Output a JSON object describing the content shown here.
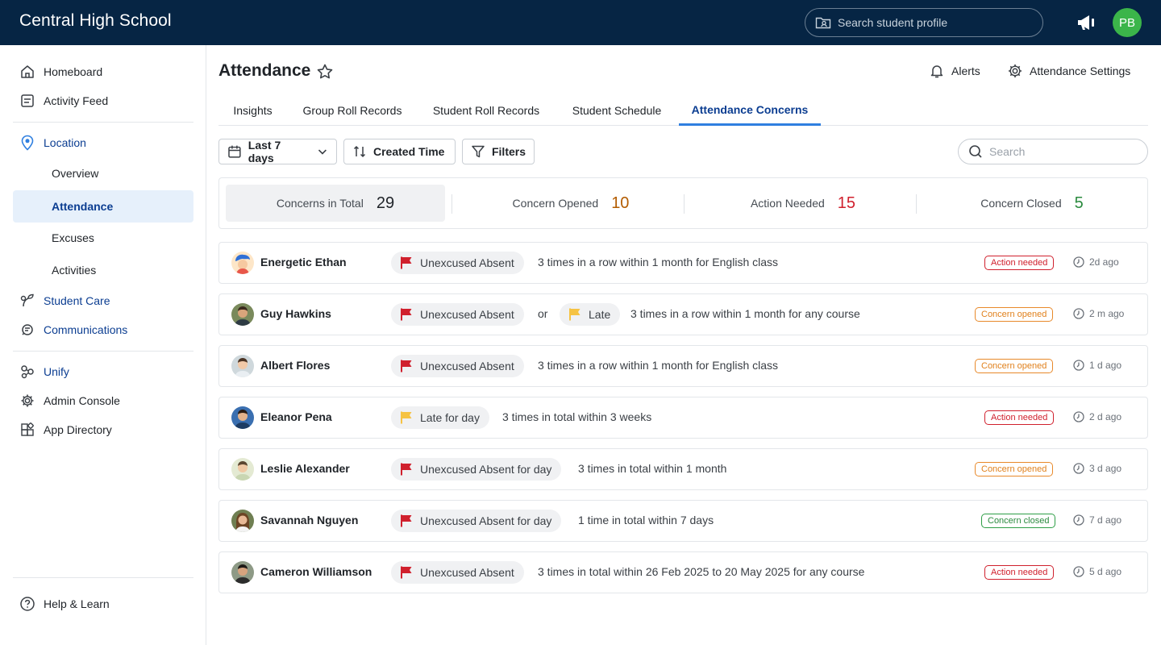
{
  "header": {
    "title": "Central High School",
    "search_placeholder": "Search student profile",
    "megaphone_icon": "megaphone-icon",
    "avatar_initials": "PB",
    "avatar_color": "#3bb54a"
  },
  "sidebar": {
    "items": [
      {
        "label": "Homeboard",
        "icon": "home-icon"
      },
      {
        "label": "Activity Feed",
        "icon": "feed-icon"
      },
      {
        "label": "Location",
        "icon": "location-pin-icon"
      },
      {
        "label": "Student Care",
        "icon": "plant-icon"
      },
      {
        "label": "Communications",
        "icon": "communications-icon"
      },
      {
        "label": "Unify",
        "icon": "unify-icon"
      },
      {
        "label": "Admin Console",
        "icon": "gear-icon"
      },
      {
        "label": "App Directory",
        "icon": "app-grid-icon"
      },
      {
        "label": "Help & Learn",
        "icon": "help-icon"
      }
    ],
    "location_sub": [
      "Overview",
      "Attendance",
      "Excuses",
      "Activities"
    ]
  },
  "page": {
    "title": "Attendance",
    "alerts_label": "Alerts",
    "settings_label": "Attendance Settings"
  },
  "tabs": [
    "Insights",
    "Group Roll Records",
    "Student Roll Records",
    "Student Schedule",
    "Attendance Concerns"
  ],
  "toolbar": {
    "date_range": "Last 7 days",
    "sort": "Created Time",
    "filters": "Filters",
    "search_placeholder": "Search"
  },
  "summary": [
    {
      "label": "Concerns in Total",
      "value": "29",
      "color": "#1f2328"
    },
    {
      "label": "Concern Opened",
      "value": "10",
      "color": "#b35c00"
    },
    {
      "label": "Action Needed",
      "value": "15",
      "color": "#d0202d"
    },
    {
      "label": "Concern Closed",
      "value": "5",
      "color": "#2a8a3e"
    }
  ],
  "concerns": [
    {
      "name": "Energetic Ethan",
      "chips": [
        {
          "label": "Unexcused Absent",
          "flag": "red"
        }
      ],
      "description": "3 times in a row within 1 month for English class",
      "status": "Action needed",
      "status_color": "red",
      "time": "2d ago"
    },
    {
      "name": "Guy Hawkins",
      "chips": [
        {
          "label": "Unexcused Absent",
          "flag": "red"
        },
        {
          "label": "Late",
          "flag": "yellow"
        }
      ],
      "joiner": "or",
      "description": "3 times in a row within 1 month for any course",
      "status": "Concern opened",
      "status_color": "orange",
      "time": "2 m ago"
    },
    {
      "name": "Albert Flores",
      "chips": [
        {
          "label": "Unexcused Absent",
          "flag": "red"
        }
      ],
      "description": "3 times in a row within 1 month for English class",
      "status": "Concern opened",
      "status_color": "orange",
      "time": "1 d ago"
    },
    {
      "name": "Eleanor Pena",
      "chips": [
        {
          "label": "Late for day",
          "flag": "yellow"
        }
      ],
      "description": "3 times in total within 3 weeks",
      "status": "Action needed",
      "status_color": "red",
      "time": "2 d ago"
    },
    {
      "name": "Leslie Alexander",
      "chips": [
        {
          "label": "Unexcused Absent for day",
          "flag": "red"
        }
      ],
      "description": "3 times in total within 1 month",
      "status": "Concern opened",
      "status_color": "orange",
      "time": "3 d ago"
    },
    {
      "name": "Savannah Nguyen",
      "chips": [
        {
          "label": "Unexcused Absent for day",
          "flag": "red"
        }
      ],
      "description": "1 time in total within 7 days",
      "status": "Concern closed",
      "status_color": "green",
      "time": "7 d ago"
    },
    {
      "name": "Cameron Williamson",
      "chips": [
        {
          "label": "Unexcused Absent",
          "flag": "red"
        }
      ],
      "description": "3 times in total within 26 Feb 2025 to 20 May 2025 for any course",
      "status": "Action needed",
      "status_color": "red",
      "time": "5 d ago"
    }
  ]
}
